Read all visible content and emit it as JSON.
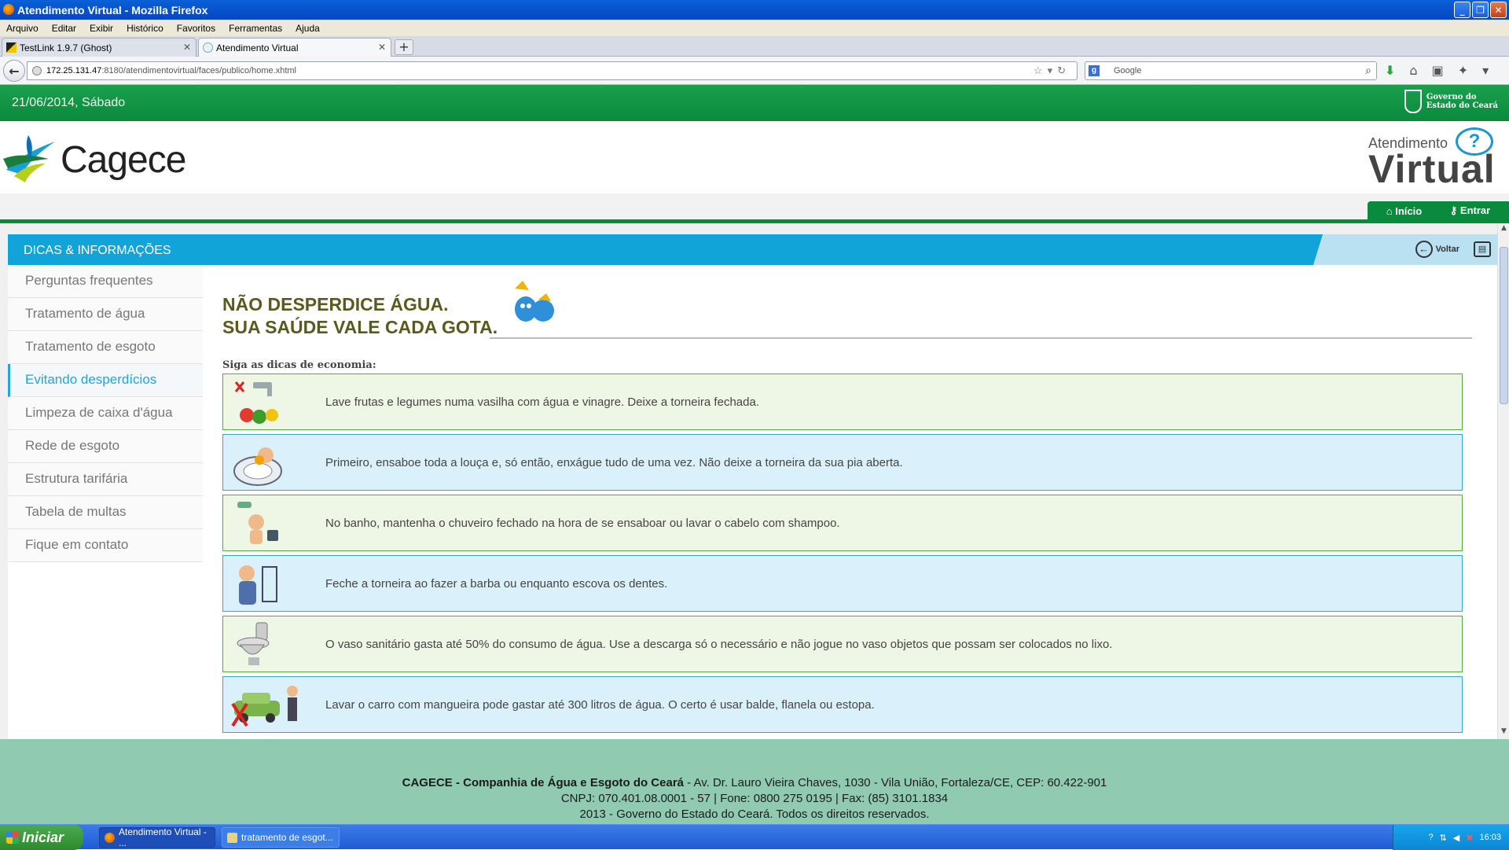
{
  "window": {
    "title": "Atendimento Virtual - Mozilla Firefox"
  },
  "menu": [
    "Arquivo",
    "Editar",
    "Exibir",
    "Histórico",
    "Favoritos",
    "Ferramentas",
    "Ajuda"
  ],
  "tabs": [
    {
      "label": "TestLink 1.9.7 (Ghost)",
      "active": false
    },
    {
      "label": "Atendimento Virtual",
      "active": true
    }
  ],
  "address": {
    "host": "172.25.131.47",
    "path": ":8180/atendimentovirtual/faces/publico/home.xhtml"
  },
  "search": {
    "engine": "g",
    "placeholder": "Google"
  },
  "site": {
    "date": "21/06/2014, Sábado",
    "gov_line1": "Governo do",
    "gov_line2": "Estado do Ceará",
    "logo_text": "Cagece",
    "av_line1": "Atendimento",
    "av_line2": "Virtual",
    "nav": {
      "home": "Início",
      "login": "Entrar"
    }
  },
  "section": {
    "title": "DICAS & INFORMAÇÕES",
    "back": "Voltar"
  },
  "sidebar": [
    {
      "label": "Perguntas frequentes"
    },
    {
      "label": "Tratamento de água"
    },
    {
      "label": "Tratamento de esgoto"
    },
    {
      "label": "Evitando desperdícios",
      "active": true
    },
    {
      "label": "Limpeza de caixa d'água"
    },
    {
      "label": "Rede de esgoto"
    },
    {
      "label": "Estrutura tarifária"
    },
    {
      "label": "Tabela de multas"
    },
    {
      "label": "Fique em contato"
    }
  ],
  "main": {
    "headline1": "NÃO DESPERDICE ÁGUA.",
    "headline2": "SUA SAÚDE VALE CADA GOTA.",
    "subtitle": "Siga as dicas de economia:",
    "tips": [
      {
        "text": "Lave frutas e legumes numa vasilha com água e vinagre. Deixe a torneira fechada.",
        "icon": "fruits-faucet-icon",
        "color": "green"
      },
      {
        "text": "Primeiro, ensaboe toda a louça e, só então, enxágue tudo de uma vez. Não deixe a torneira da sua pia aberta.",
        "icon": "dish-washing-icon",
        "color": "blue"
      },
      {
        "text": "No banho, mantenha o chuveiro fechado na hora de se ensaboar ou lavar o cabelo com shampoo.",
        "icon": "shower-icon",
        "color": "green"
      },
      {
        "text": "Feche a torneira ao fazer a barba ou enquanto escova os dentes.",
        "icon": "shaving-icon",
        "color": "blue"
      },
      {
        "text": "O vaso sanitário gasta até 50% do consumo de água. Use a descarga só o necessário e não jogue no vaso objetos que possam ser colocados no lixo.",
        "icon": "toilet-icon",
        "color": "green"
      },
      {
        "text": "Lavar o carro com mangueira pode gastar até 300 litros de água. O certo é usar balde, flanela ou estopa.",
        "icon": "car-wash-icon",
        "color": "blue"
      }
    ]
  },
  "footer": {
    "company": "CAGECE - Companhia de Água e Esgoto do Ceará",
    "address": " - Av. Dr. Lauro Vieira Chaves, 1030 - Vila União, Fortaleza/CE, CEP: 60.422-901",
    "line2": "CNPJ: 070.401.08.0001 - 57 | Fone: 0800 275 0195 | Fax: (85) 3101.1834",
    "line3": "2013 - Governo do Estado do Ceará. Todos os direitos reservados."
  },
  "taskbar": {
    "start": "Iniciar",
    "items": [
      "Atendimento Virtual - ...",
      "tratamento de esgot..."
    ],
    "clock": "16:03"
  },
  "colors": {
    "green": "#0a8a3c",
    "blue": "#10a4d9",
    "footer": "#8fcab1"
  }
}
